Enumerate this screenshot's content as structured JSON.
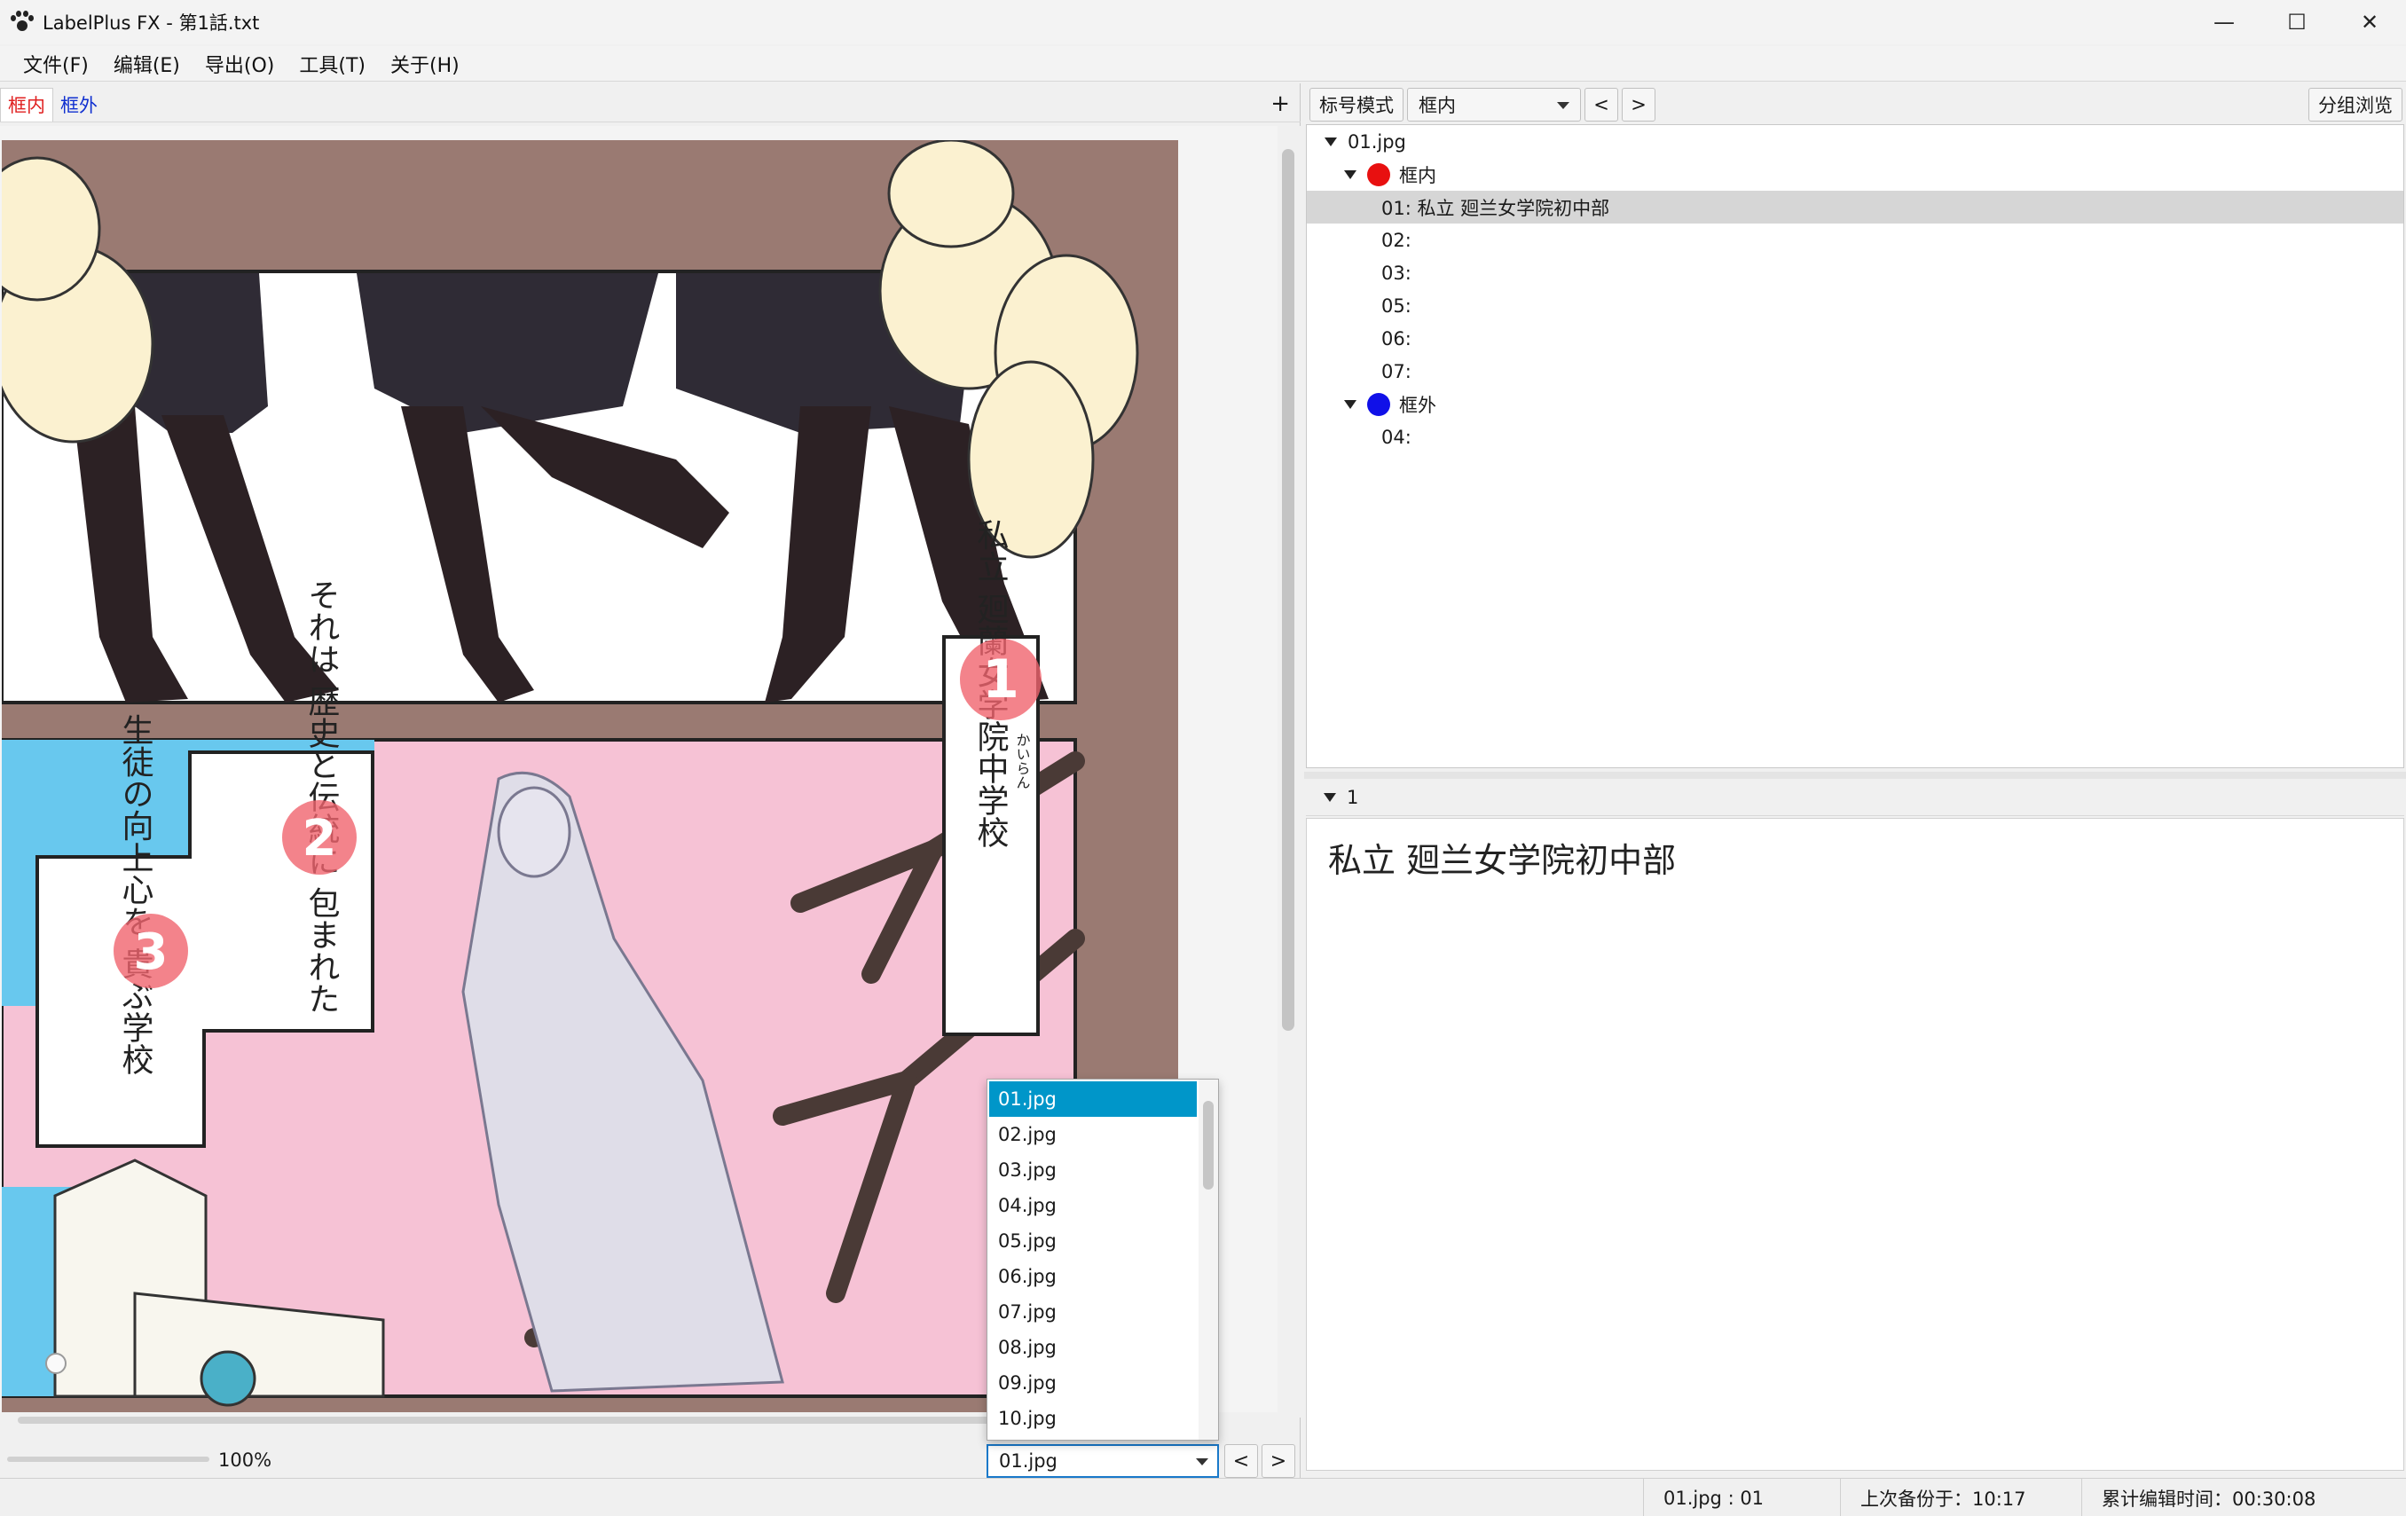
{
  "window": {
    "title": "LabelPlus FX - 第1話.txt",
    "minimize": "—",
    "maximize": "☐",
    "close": "✕"
  },
  "menu": [
    "文件(F)",
    "编辑(E)",
    "导出(O)",
    "工具(T)",
    "关于(H)"
  ],
  "left": {
    "group_tabs": [
      {
        "label": "框内",
        "color": "#e02020"
      },
      {
        "label": "框外",
        "color": "#1030d0"
      }
    ],
    "add_tab": "+",
    "zoom": "100%",
    "current_file": "01.jpg",
    "prev": "<",
    "next": ">",
    "file_list": [
      "01.jpg",
      "02.jpg",
      "03.jpg",
      "04.jpg",
      "05.jpg",
      "06.jpg",
      "07.jpg",
      "08.jpg",
      "09.jpg",
      "10.jpg"
    ],
    "labels_on_image": [
      "1",
      "2",
      "3"
    ],
    "image_text": {
      "box1": "私立 廻蘭女学院中学校",
      "ruby": "かいらん",
      "box2": "それは 歴史と伝統に 包まれた",
      "box3": "生徒の向上心を 貴ぶ学校"
    }
  },
  "right": {
    "mode_button": "标号模式",
    "group_select": "框内",
    "prev": "<",
    "next": ">",
    "group_view_button": "分组浏览",
    "tree": {
      "file": "01.jpg",
      "groups": [
        {
          "name": "框内",
          "color": "#e81010",
          "items": [
            "01: 私立 廻兰女学院初中部",
            "02:",
            "03:",
            "05:",
            "06:",
            "07:"
          ]
        },
        {
          "name": "框外",
          "color": "#1010e8",
          "items": [
            "04:"
          ]
        }
      ]
    },
    "selected_label_index": "1",
    "text_content": "私立  廻兰女学院初中部"
  },
  "status": {
    "position": "01.jpg : 01",
    "backup": "上次备份于：10:17",
    "edit_time": "累计编辑时间：00:30:08"
  }
}
